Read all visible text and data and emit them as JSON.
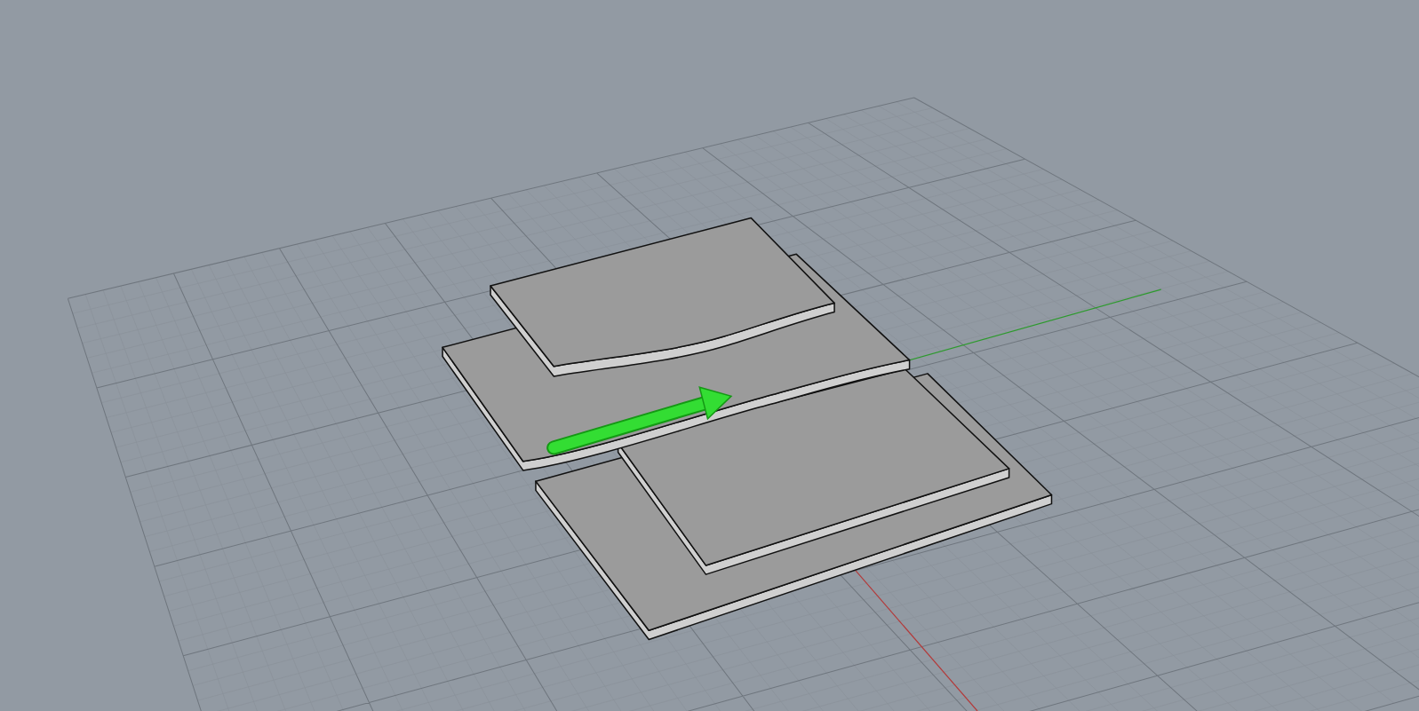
{
  "arrow": {
    "selected": true
  }
}
